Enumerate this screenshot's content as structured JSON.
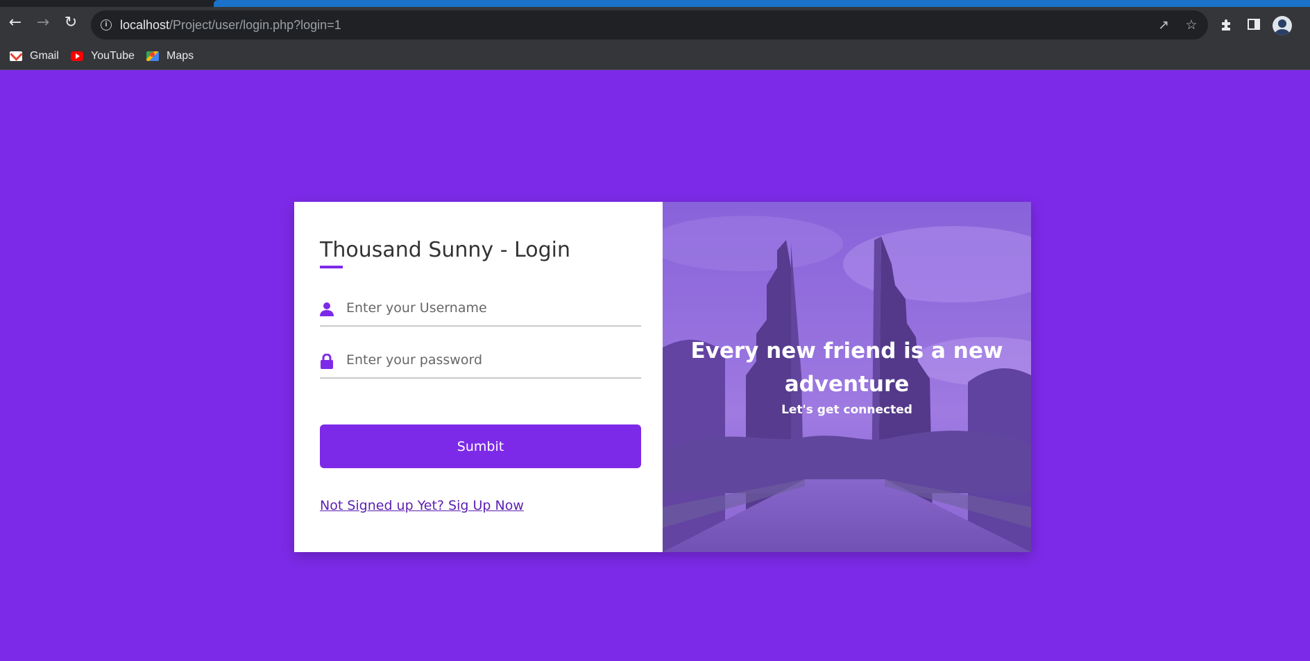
{
  "browser": {
    "url_host": "localhost",
    "url_path": "/Project/user/login.php?login=1",
    "bookmarks": [
      {
        "label": "Gmail",
        "icon": "gmail-icon"
      },
      {
        "label": "YouTube",
        "icon": "youtube-icon"
      },
      {
        "label": "Maps",
        "icon": "maps-icon"
      }
    ]
  },
  "login": {
    "title": "Thousand Sunny - Login",
    "username_placeholder": "Enter your Username",
    "password_placeholder": "Enter your password",
    "submit_label": "Sumbit",
    "signup_link": "Not Signed up Yet? Sig Up Now"
  },
  "banner": {
    "headline": "Every new friend is a new adventure",
    "subline": "Let's get connected"
  },
  "colors": {
    "accent": "#7d2ae8",
    "page_background": "#7d2ae8",
    "card_background": "#ffffff"
  }
}
